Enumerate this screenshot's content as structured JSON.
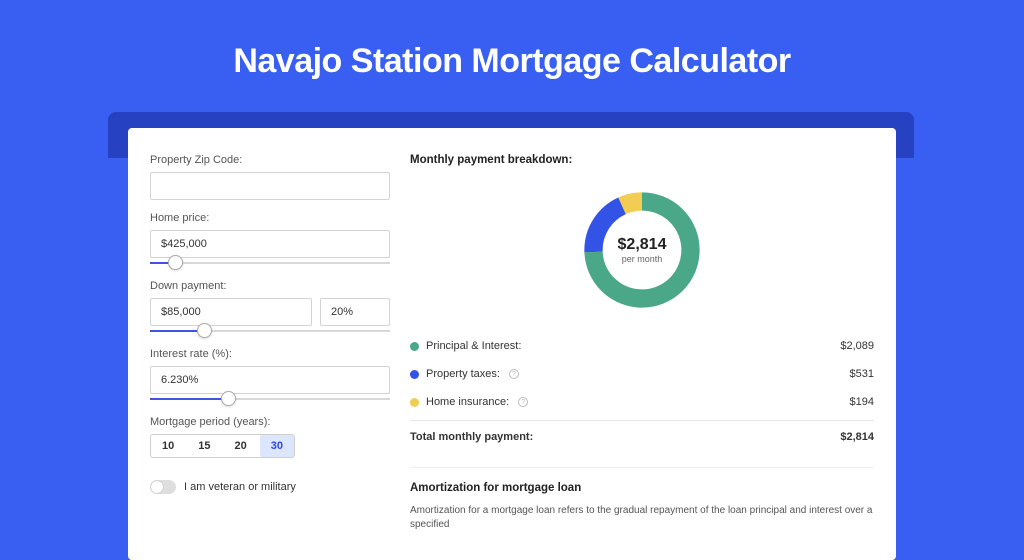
{
  "title": "Navajo Station Mortgage Calculator",
  "form": {
    "zip_label": "Property Zip Code:",
    "zip_value": "",
    "home_price_label": "Home price:",
    "home_price_value": "$425,000",
    "down_payment_label": "Down payment:",
    "down_payment_value": "$85,000",
    "down_payment_pct": "20%",
    "interest_label": "Interest rate (%):",
    "interest_value": "6.230%",
    "period_label": "Mortgage period (years):",
    "periods": [
      "10",
      "15",
      "20",
      "30"
    ],
    "period_selected_index": 3,
    "veteran_label": "I am veteran or military"
  },
  "breakdown": {
    "heading": "Monthly payment breakdown:",
    "center_amount": "$2,814",
    "center_sub": "per month",
    "rows": [
      {
        "id": "pi",
        "color": "green",
        "label": "Principal & Interest:",
        "info": false,
        "value": "$2,089"
      },
      {
        "id": "tax",
        "color": "blue",
        "label": "Property taxes:",
        "info": true,
        "value": "$531"
      },
      {
        "id": "ins",
        "color": "yellow",
        "label": "Home insurance:",
        "info": true,
        "value": "$194"
      }
    ],
    "total_label": "Total monthly payment:",
    "total_value": "$2,814"
  },
  "amortization": {
    "heading": "Amortization for mortgage loan",
    "text": "Amortization for a mortgage loan refers to the gradual repayment of the loan principal and interest over a specified"
  },
  "chart_data": {
    "type": "pie",
    "title": "Monthly payment breakdown",
    "series": [
      {
        "name": "Principal & Interest",
        "value": 2089,
        "color": "#4aa889"
      },
      {
        "name": "Property taxes",
        "value": 531,
        "color": "#3253e5"
      },
      {
        "name": "Home insurance",
        "value": 194,
        "color": "#f2cc53"
      }
    ],
    "total": 2814,
    "unit": "USD per month"
  }
}
